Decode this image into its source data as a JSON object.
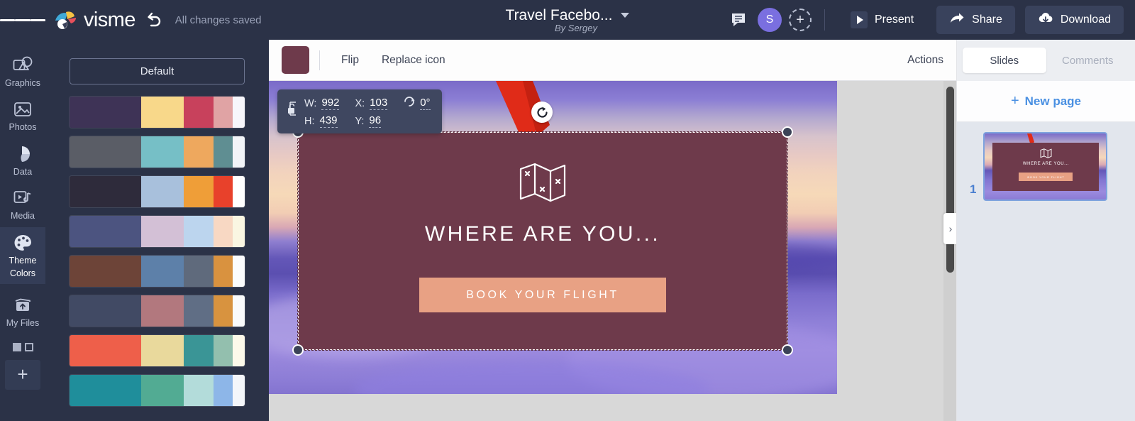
{
  "topbar": {
    "menu_icon": "hamburger-icon",
    "brand_name": "visme",
    "undo_icon": "undo-icon",
    "save_status": "All changes saved",
    "doc_title": "Travel Facebo...",
    "doc_author": "By Sergey",
    "comment_icon": "comment-icon",
    "avatar_initial": "S",
    "add_user_icon": "add-user-icon",
    "present_label": "Present",
    "share_label": "Share",
    "download_label": "Download"
  },
  "leftnav": {
    "items": [
      {
        "label": "Graphics",
        "icon": "graphics-icon",
        "active": false
      },
      {
        "label": "Photos",
        "icon": "photos-icon",
        "active": false
      },
      {
        "label": "Data",
        "icon": "data-icon",
        "active": false
      },
      {
        "label": "Media",
        "icon": "media-icon",
        "active": false
      },
      {
        "label": "Theme\nColors",
        "label_line1": "Theme",
        "label_line2": "Colors",
        "icon": "palette-icon",
        "active": true
      },
      {
        "label": "My Files",
        "icon": "my-files-icon",
        "active": false
      }
    ],
    "add_label": "+"
  },
  "theme_panel": {
    "default_label": "Default",
    "palettes": [
      {
        "name": "palette-1",
        "colors": [
          "#3e3356",
          "#f8d88a",
          "#c8415c",
          "#e0a3a4",
          "#f7f6fb"
        ]
      },
      {
        "name": "palette-2",
        "colors": [
          "#5a5d66",
          "#76bfc6",
          "#eea85e",
          "#5f8e92",
          "#f2f4f8"
        ]
      },
      {
        "name": "palette-3",
        "colors": [
          "#2e2b3b",
          "#a8c0dc",
          "#ef9e38",
          "#e8412b",
          "#ffffff"
        ]
      },
      {
        "name": "palette-4",
        "colors": [
          "#4c5480",
          "#d3c0d6",
          "#bcd5ee",
          "#f8d8c3",
          "#faf6e2"
        ]
      },
      {
        "name": "palette-5",
        "colors": [
          "#6d4438",
          "#5d80a9",
          "#5f6a7c",
          "#d9923f",
          "#fbfcfd"
        ]
      },
      {
        "name": "palette-6",
        "colors": [
          "#414a64",
          "#b2787e",
          "#606e85",
          "#d8933f",
          "#fafbfc"
        ]
      },
      {
        "name": "palette-7",
        "colors": [
          "#ee5f4a",
          "#e9d99c",
          "#3a9596",
          "#93bfae",
          "#fcf9ea"
        ]
      },
      {
        "name": "palette-8",
        "colors": [
          "#1f8e9b",
          "#52ab93",
          "#b3dcda",
          "#8db6e8",
          "#f4f6fa"
        ]
      }
    ]
  },
  "editor_toolbar": {
    "swatch_color": "#6e3a4b",
    "flip_label": "Flip",
    "replace_icon_label": "Replace icon",
    "actions_label": "Actions"
  },
  "right_panel": {
    "tab_slides": "Slides",
    "tab_comments": "Comments",
    "new_page_label": "New page",
    "new_page_plus": "+",
    "slides": [
      {
        "number": "1",
        "selected": true
      }
    ]
  },
  "canvas": {
    "selection": {
      "w_label": "W:",
      "w_value": "992",
      "h_label": "H:",
      "h_value": "439",
      "x_label": "X:",
      "x_value": "103",
      "y_label": "Y:",
      "y_value": "96",
      "rotation_value": "0°",
      "lock_icon": "lock-open-icon",
      "rotate_icon": "rotate-icon"
    },
    "slide": {
      "shape_color": "#6e3a4b",
      "map_icon": "folded-map-icon",
      "headline": "WHERE ARE YOU...",
      "cta_label": "BOOK YOUR FLIGHT",
      "cta_color": "#e8a184"
    }
  },
  "scroll": {
    "collapse_icon": "chevron-right-icon"
  }
}
